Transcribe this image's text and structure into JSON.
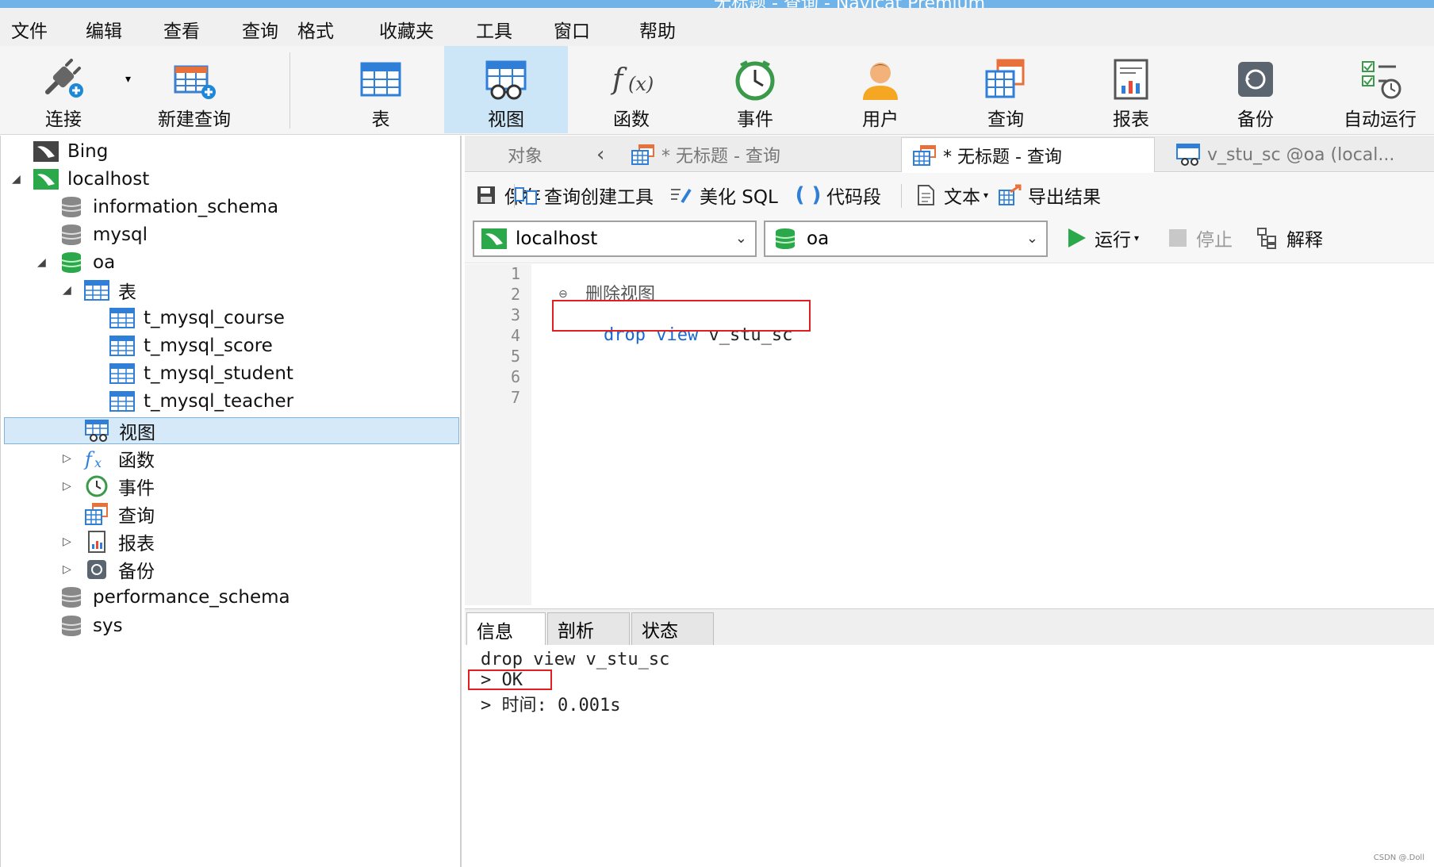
{
  "window": {
    "title": "无标题 - 查询 - Navicat Premium"
  },
  "menu": [
    "文件",
    "编辑",
    "查看",
    "查询",
    "格式",
    "收藏夹",
    "工具",
    "窗口",
    "帮助"
  ],
  "toolbar": {
    "connect": "连接",
    "new_query": "新建查询",
    "table": "表",
    "view": "视图",
    "function": "函数",
    "event": "事件",
    "user": "用户",
    "query": "查询",
    "report": "报表",
    "backup": "备份",
    "automation": "自动运行"
  },
  "tree": {
    "bing": "Bing",
    "localhost": "localhost",
    "information_schema": "information_schema",
    "mysql": "mysql",
    "oa": "oa",
    "tables": "表",
    "t1": "t_mysql_course",
    "t2": "t_mysql_score",
    "t3": "t_mysql_student",
    "t4": "t_mysql_teacher",
    "views": "视图",
    "functions": "函数",
    "events": "事件",
    "queries": "查询",
    "reports": "报表",
    "backups": "备份",
    "performance_schema": "performance_schema",
    "sys": "sys"
  },
  "tabs": {
    "objects": "对象",
    "tab1": "* 无标题 - 查询",
    "tab2": "* 无标题 - 查询",
    "tab3": "v_stu_sc @oa (local..."
  },
  "query_toolbar": {
    "save": "保存",
    "builder": "查询创建工具",
    "beautify": "美化 SQL",
    "snippet": "代码段",
    "text": "文本",
    "export": "导出结果"
  },
  "connection": {
    "server": "localhost",
    "database": "oa"
  },
  "run": {
    "run": "运行",
    "stop": "停止",
    "explain": "解释"
  },
  "editor": {
    "line_numbers": [
      "1",
      "2",
      "3",
      "4",
      "5",
      "6",
      "7"
    ],
    "comment": "删除视图",
    "code_kw1": "drop",
    "code_kw2": "view",
    "code_id": "v_stu_sc"
  },
  "result_tabs": {
    "info": "信息",
    "profile": "剖析",
    "status": "状态"
  },
  "result": {
    "line1": "drop view v_stu_sc",
    "line2": "> OK",
    "line3": "> 时间: 0.001s"
  },
  "watermark": "CSDN @.Doll",
  "colors": {
    "accent": "#cde6f7",
    "keyword": "#1a66d0",
    "highlight_box": "#e02020"
  }
}
